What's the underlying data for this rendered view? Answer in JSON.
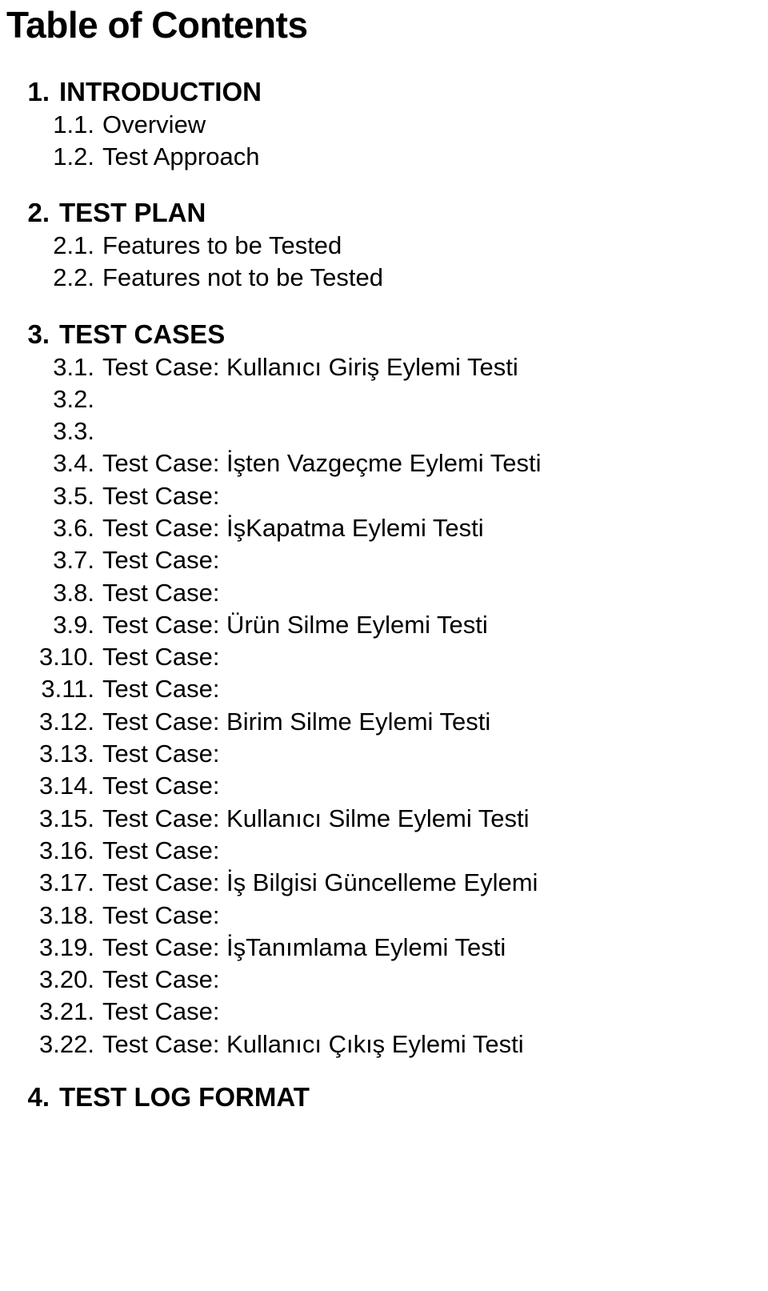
{
  "document": {
    "title": "Table of Contents"
  },
  "toc": [
    {
      "level": 1,
      "number": "1.",
      "label": "INTRODUCTION",
      "gap": "sp-before-1"
    },
    {
      "level": 2,
      "number": "1.1.",
      "label": "Overview",
      "gap": ""
    },
    {
      "level": 2,
      "number": "1.2.",
      "label": "Test Approach",
      "gap": ""
    },
    {
      "level": 1,
      "number": "2.",
      "label": "TEST PLAN",
      "gap": "sp-before-2"
    },
    {
      "level": 2,
      "number": "2.1.",
      "label": "Features to be Tested",
      "gap": ""
    },
    {
      "level": 2,
      "number": "2.2.",
      "label": "Features not to be Tested",
      "gap": ""
    },
    {
      "level": 1,
      "number": "3.",
      "label": "TEST CASES",
      "gap": "sp-before-3"
    },
    {
      "level": 2,
      "number": "3.1.",
      "label": "Test Case: Kullanıcı Giriş  Eylemi Testi",
      "gap": ""
    },
    {
      "level": 2,
      "number": "3.2.",
      "label": "",
      "gap": ""
    },
    {
      "level": 2,
      "number": "3.3.",
      "label": "",
      "gap": ""
    },
    {
      "level": 2,
      "number": "3.4.",
      "label": "Test Case: İşten Vazgeçme  Eylemi Testi",
      "gap": ""
    },
    {
      "level": 2,
      "number": "3.5.",
      "label": "Test Case:",
      "gap": ""
    },
    {
      "level": 2,
      "number": "3.6.",
      "label": "Test Case: İşKapatma  Eylemi Testi",
      "gap": ""
    },
    {
      "level": 2,
      "number": "3.7.",
      "label": "Test Case:",
      "gap": ""
    },
    {
      "level": 2,
      "number": "3.8.",
      "label": "Test Case:",
      "gap": ""
    },
    {
      "level": 2,
      "number": "3.9.",
      "label": "Test Case: Ürün Silme Eylemi Testi",
      "gap": ""
    },
    {
      "level": 2,
      "number": "3.10.",
      "label": "Test Case:",
      "gap": ""
    },
    {
      "level": 2,
      "number": "3.11.",
      "label": "Test Case:",
      "gap": ""
    },
    {
      "level": 2,
      "number": "3.12.",
      "label": "Test Case: Birim Silme Eylemi Testi",
      "gap": ""
    },
    {
      "level": 2,
      "number": "3.13.",
      "label": "Test Case:",
      "gap": ""
    },
    {
      "level": 2,
      "number": "3.14.",
      "label": "Test Case:",
      "gap": ""
    },
    {
      "level": 2,
      "number": "3.15.",
      "label": "Test Case: Kullanıcı Silme Eylemi Testi",
      "gap": ""
    },
    {
      "level": 2,
      "number": "3.16.",
      "label": "Test Case:",
      "gap": ""
    },
    {
      "level": 2,
      "number": "3.17.",
      "label": "Test Case: İş Bilgisi Güncelleme Eylemi",
      "gap": ""
    },
    {
      "level": 2,
      "number": "3.18.",
      "label": "Test Case:",
      "gap": ""
    },
    {
      "level": 2,
      "number": "3.19.",
      "label": "Test Case: İşTanımlama  Eylemi Testi",
      "gap": ""
    },
    {
      "level": 2,
      "number": "3.20.",
      "label": "Test Case:",
      "gap": ""
    },
    {
      "level": 2,
      "number": "3.21.",
      "label": "Test Case:",
      "gap": ""
    },
    {
      "level": 2,
      "number": "3.22.",
      "label": "Test Case: Kullanıcı Çıkış  Eylemi Testi",
      "gap": ""
    },
    {
      "level": 1,
      "number": "4.",
      "label": "TEST LOG FORMAT",
      "gap": "sp-before-4"
    }
  ]
}
